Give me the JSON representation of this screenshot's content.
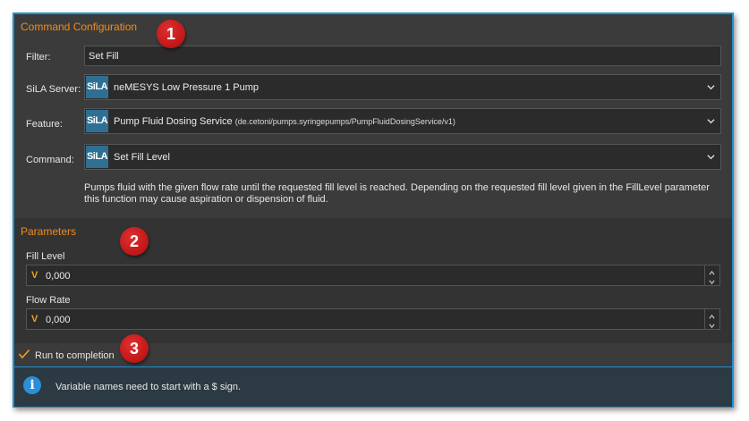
{
  "command_config": {
    "title": "Command Configuration",
    "filter_label": "Filter:",
    "filter_value": "Set Fill",
    "server_label": "SiLA Server:",
    "server_value": "neMESYS Low Pressure 1 Pump",
    "feature_label": "Feature:",
    "feature_value": "Pump Fluid Dosing Service",
    "feature_id": "(de.cetoni/pumps.syringepumps/PumpFluidDosingService/v1)",
    "command_label": "Command:",
    "command_value": "Set Fill Level",
    "sila_badge": "SiLA",
    "description": "Pumps fluid with the given flow rate until the requested fill level is reached. Depending on the requested fill level given in the FillLevel parameter this function may cause aspiration or dispension of fluid."
  },
  "parameters": {
    "title": "Parameters",
    "fill_level_label": "Fill Level",
    "fill_level_value": "0,000",
    "flow_rate_label": "Flow Rate",
    "flow_rate_value": "0,000",
    "variable_prefix": "V"
  },
  "run_to_completion": {
    "label": "Run to completion",
    "checked": true
  },
  "info": {
    "text": "Variable names need to start with a $ sign."
  },
  "callouts": [
    "1",
    "2",
    "3"
  ],
  "colors": {
    "accent": "#f08c1e",
    "border": "#1d90d6",
    "callout": "#c41a1a",
    "sila": "#2f6f93"
  }
}
